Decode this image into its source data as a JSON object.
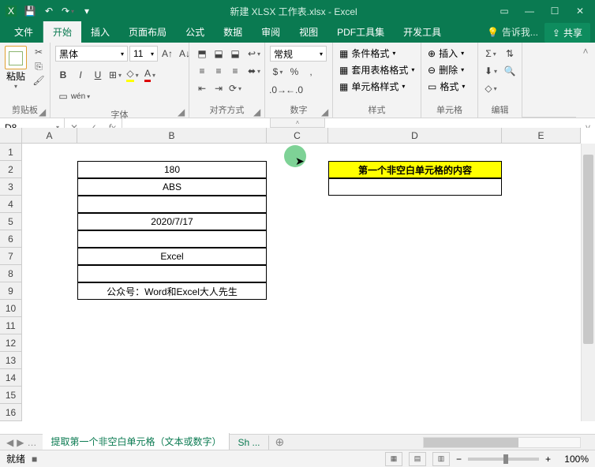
{
  "titlebar": {
    "title": "新建 XLSX 工作表.xlsx - Excel"
  },
  "tabs": {
    "file": "文件",
    "home": "开始",
    "insert": "插入",
    "layout": "页面布局",
    "formulas": "公式",
    "data": "数据",
    "review": "审阅",
    "view": "视图",
    "pdf": "PDF工具集",
    "dev": "开发工具",
    "tell": "告诉我...",
    "share": "共享"
  },
  "ribbon": {
    "clipboard": {
      "label": "剪贴板",
      "paste": "粘贴"
    },
    "font": {
      "label": "字体",
      "name": "黑体",
      "size": "11"
    },
    "align": {
      "label": "对齐方式"
    },
    "number": {
      "label": "数字",
      "format": "常规"
    },
    "styles": {
      "label": "样式",
      "cond": "条件格式",
      "table": "套用表格格式",
      "cell": "单元格样式"
    },
    "cells": {
      "label": "单元格",
      "insert": "插入",
      "delete": "删除",
      "format": "格式"
    },
    "editing": {
      "label": "编辑"
    }
  },
  "namebox": "D8",
  "cols": {
    "A": 70,
    "B": 240,
    "C": 78,
    "D": 220,
    "E": 100
  },
  "rows": 16,
  "cells": {
    "B2": "180",
    "B3": "ABS",
    "B5": "2020/7/17",
    "B7": "Excel",
    "B9": "公众号：Word和Excel大人先生",
    "D2": "第一个非空白单元格的内容"
  },
  "sheets": {
    "active": "提取第一个非空白单元格（文本或数字）",
    "other": "Sh ..."
  },
  "status": {
    "ready": "就绪",
    "rec": "■",
    "zoom": "100%"
  }
}
